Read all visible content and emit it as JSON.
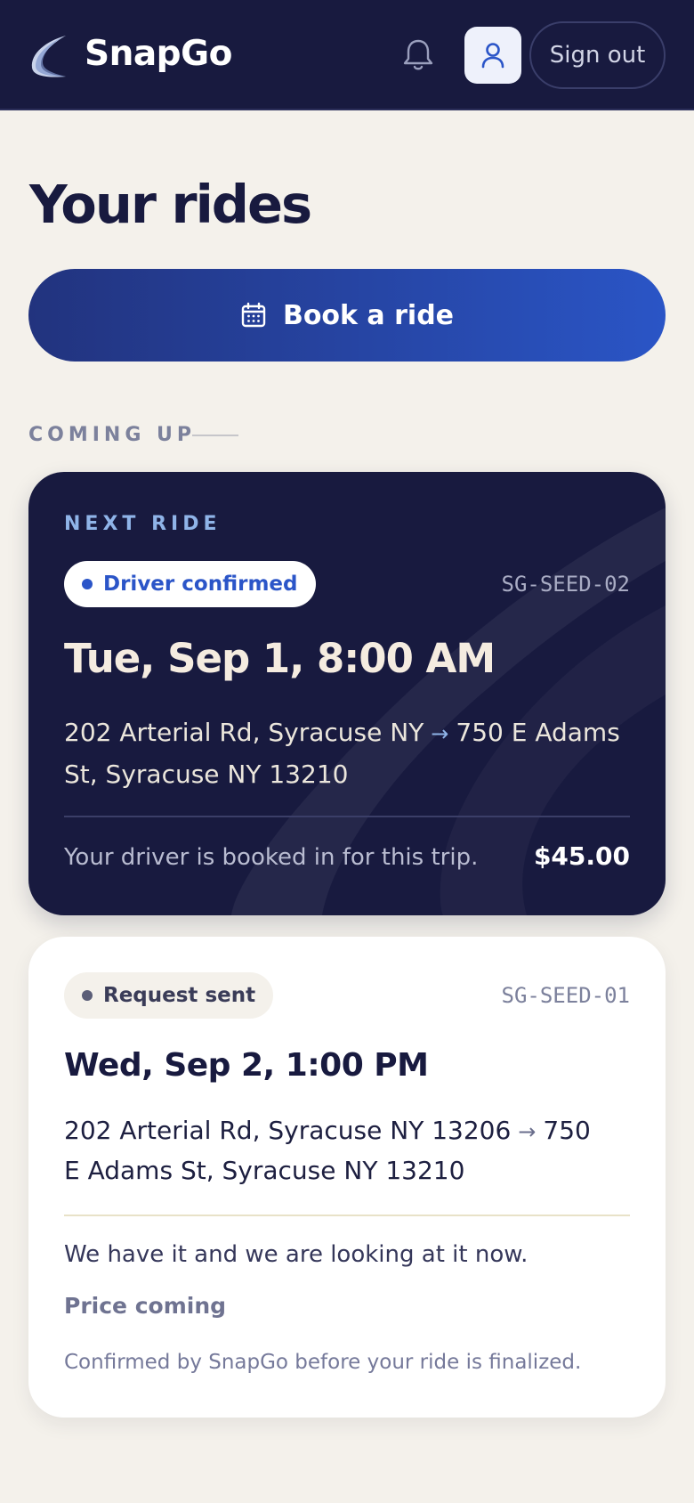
{
  "header": {
    "brand": "SnapGo",
    "sign_out_label": "Sign out",
    "icons": {
      "logo": "snapgo-swoosh-logo",
      "notifications": "bell-icon",
      "profile": "user-icon"
    }
  },
  "page": {
    "title": "Your rides",
    "book_label": "Book a ride",
    "book_icon": "calendar-icon",
    "section_label": "COMING UP"
  },
  "rides": [
    {
      "eyebrow": "NEXT RIDE",
      "status": "Driver confirmed",
      "reference": "SG-SEED-02",
      "when": "Tue, Sep 1, 8:00 AM",
      "from": "202 Arterial Rd, Syracuse NY",
      "to": "750 E Adams St, Syracuse NY 13210",
      "message": "Your driver is booked in for this trip.",
      "price": "$45.00"
    },
    {
      "status": "Request sent",
      "reference": "SG-SEED-01",
      "when": "Wed, Sep 2, 1:00 PM",
      "from": "202 Arterial Rd, Syracuse NY 13206",
      "to": "750 E Adams St, Syracuse NY 13210",
      "message": "We have it and we are looking at it now.",
      "price": "Price coming",
      "note": "Confirmed by SnapGo before your ride is finalized."
    }
  ],
  "colors": {
    "navy": "#181a3f",
    "accent_blue": "#2b55c8",
    "background": "#f4f1eb",
    "card_light": "#ffffff"
  }
}
